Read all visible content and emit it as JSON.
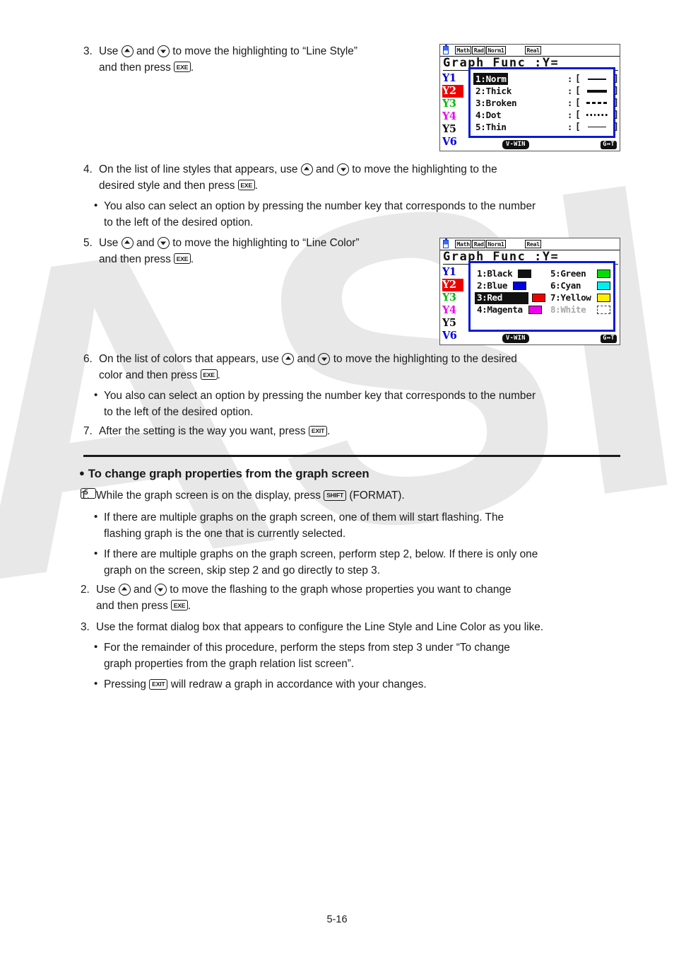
{
  "page": {
    "number": "5-16"
  },
  "steps": {
    "s3": {
      "num": "3.",
      "pre": "Use",
      "mid": "and",
      "post": "to move the highlighting to “Line Style”",
      "line2_pre": "and then press",
      "line2_post": "."
    },
    "s4": {
      "num": "4.",
      "pre": "On the list of line styles that appears, use",
      "mid": "and",
      "post": "to move the highlighting to the",
      "line2_pre": "desired style and then press",
      "line2_post": "."
    },
    "s4_bullet": {
      "line1": "You also can select an option by pressing the number key that corresponds to the number",
      "line2": "to the left of the desired option."
    },
    "s5": {
      "num": "5.",
      "pre": "Use",
      "mid": "and",
      "post": "to move the highlighting to “Line Color”",
      "line2_pre": "and then press",
      "line2_post": "."
    },
    "s6": {
      "num": "6.",
      "pre": "On the list of colors that appears, use",
      "mid": "and",
      "post": "to move the highlighting to the desired",
      "line2_pre": "color and then press",
      "line2_post": "."
    },
    "s6_bullet": {
      "line1": "You also can select an option by pressing the number key that corresponds to the number",
      "line2": "to the left of the desired option."
    },
    "s7": {
      "num": "7.",
      "pre": "After the setting is the way you want, press",
      "post": "."
    }
  },
  "section": {
    "heading": "To change graph properties from the graph screen",
    "s1": {
      "num": "1.",
      "pre": "While the graph screen is on the display, press",
      "post": "(FORMAT)."
    },
    "s1_bullet1": {
      "line1": "If there are multiple graphs on the graph screen, one of them will start flashing. The",
      "line2": "flashing graph is the one that is currently selected."
    },
    "s1_bullet2": {
      "line1": "If there are multiple graphs on the graph screen, perform step 2, below. If there is only one",
      "line2": "graph on the screen, skip step 2 and go directly to step 3."
    },
    "s2": {
      "num": "2.",
      "pre": "Use",
      "mid": "and",
      "post": "to move the flashing to the graph whose properties you want to change",
      "line2_pre": "and then press",
      "line2_post": "."
    },
    "s3": {
      "num": "3.",
      "text": "Use the format dialog box that appears to configure the Line Style and Line Color as you like."
    },
    "s3_bullet1": {
      "line1": "For the remainder of this procedure, perform the steps from step 3 under “To change",
      "line2": "graph properties from the graph relation list screen”."
    },
    "s3_bullet2": {
      "pre": "Pressing",
      "post": "will redraw a graph in accordance with your changes."
    }
  },
  "keys": {
    "exe": "EXE",
    "exit": "EXIT",
    "shift": "SHIFT",
    "five": "5"
  },
  "calc_screen_1": {
    "status": {
      "math": "Math",
      "rad": "Rad",
      "norm": "Norm1",
      "real": "Real"
    },
    "title": "Graph Func :Y=",
    "y_labels": [
      {
        "text": "Y1",
        "color": "#0000dd",
        "highlighted": false
      },
      {
        "text": "Y2",
        "color": "#ee0000",
        "highlighted": true
      },
      {
        "text": "Y3",
        "color": "#00bb00",
        "highlighted": false
      },
      {
        "text": "Y4",
        "color": "#ee00ee",
        "highlighted": false
      },
      {
        "text": "Y5",
        "color": "#111111",
        "highlighted": false
      },
      {
        "text": "V6",
        "color": "#0000dd",
        "highlighted": false
      }
    ],
    "right_chip_color": "#ee0000",
    "bottom": {
      "vwin": "V-WIN",
      "gt": "G↔T"
    },
    "dialog": {
      "name": "line-style-dialog",
      "rows": [
        {
          "label": "1:Norm",
          "style": "s-norm",
          "highlighted": true
        },
        {
          "label": "2:Thick",
          "style": "s-thick",
          "highlighted": false
        },
        {
          "label": "3:Broken",
          "style": "s-broken",
          "highlighted": false
        },
        {
          "label": "4:Dot",
          "style": "s-dot",
          "highlighted": false
        },
        {
          "label": "5:Thin",
          "style": "s-thin",
          "highlighted": false
        }
      ],
      "colon": ":",
      "bracket_open": "[",
      "bracket_close": "]"
    }
  },
  "calc_screen_2": {
    "status": {
      "math": "Math",
      "rad": "Rad",
      "norm": "Norm1",
      "real": "Real"
    },
    "title": "Graph Func :Y=",
    "y_labels": [
      {
        "text": "Y1",
        "color": "#0000dd",
        "highlighted": false
      },
      {
        "text": "Y2",
        "color": "#ee0000",
        "highlighted": true
      },
      {
        "text": "Y3",
        "color": "#00bb00",
        "highlighted": false
      },
      {
        "text": "Y4",
        "color": "#ee00ee",
        "highlighted": false
      },
      {
        "text": "Y5",
        "color": "#111111",
        "highlighted": false
      },
      {
        "text": "V6",
        "color": "#0000dd",
        "highlighted": false
      }
    ],
    "right_chip_color": "#ee0000",
    "bottom": {
      "vwin": "V-WIN",
      "gt": "G↔T"
    },
    "dialog": {
      "name": "line-color-dialog",
      "left_column": [
        {
          "label": "1:Black",
          "swatch": "#111111",
          "highlighted": false,
          "dim": false
        },
        {
          "label": "2:Blue",
          "swatch": "#0000dd",
          "highlighted": false,
          "dim": false
        },
        {
          "label": "3:Red",
          "swatch": "#ee0000",
          "highlighted": true,
          "dim": false
        },
        {
          "label": "4:Magenta",
          "swatch": "#ee00ee",
          "highlighted": false,
          "dim": false
        }
      ],
      "right_column": [
        {
          "label": "5:Green",
          "swatch": "#00dd00",
          "highlighted": false,
          "dim": false
        },
        {
          "label": "6:Cyan",
          "swatch": "#00eeee",
          "highlighted": false,
          "dim": false
        },
        {
          "label": "7:Yellow",
          "swatch": "#ffee00",
          "highlighted": false,
          "dim": false
        },
        {
          "label": "8:White",
          "swatch": "dashed",
          "highlighted": false,
          "dim": true
        }
      ]
    }
  },
  "watermark": {
    "text": "CASIO",
    "color": "#e8e8e8"
  }
}
